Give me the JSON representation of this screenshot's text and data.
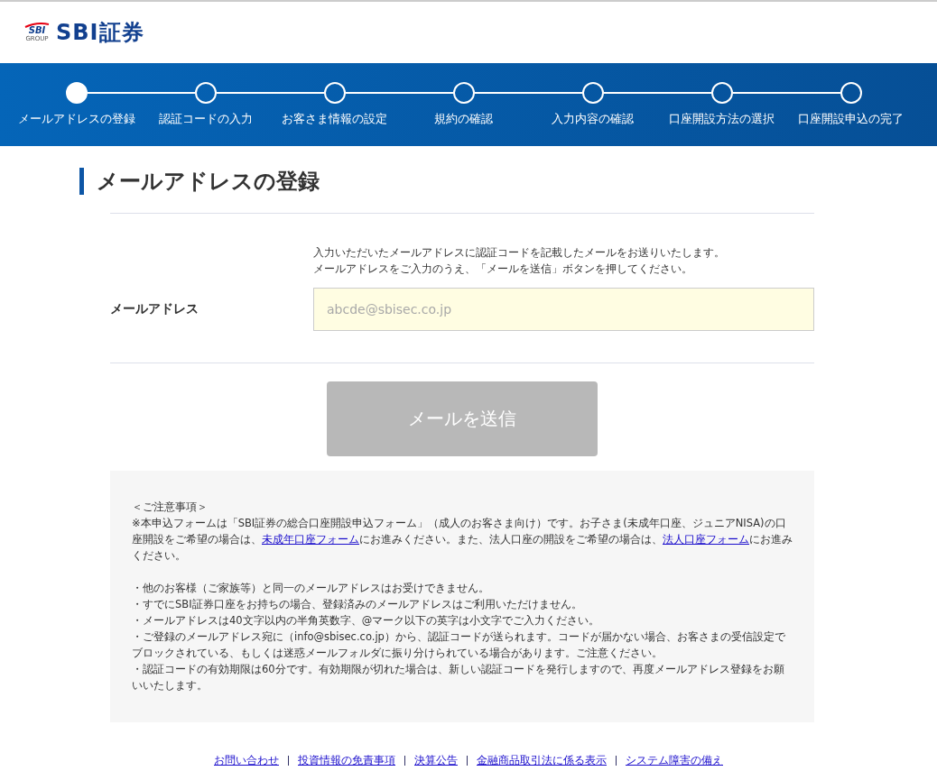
{
  "logo": {
    "badge": "SBI",
    "group": "GROUP",
    "name": "SBI証券"
  },
  "steps": [
    {
      "label": "メールアドレスの登録",
      "selected": true
    },
    {
      "label": "認証コードの入力",
      "selected": false
    },
    {
      "label": "お客さま情報の設定",
      "selected": false
    },
    {
      "label": "規約の確認",
      "selected": false
    },
    {
      "label": "入力内容の確認",
      "selected": false
    },
    {
      "label": "口座開設方法の選択",
      "selected": false
    },
    {
      "label": "口座開設申込の完了",
      "selected": false
    }
  ],
  "page_title": "メールアドレスの登録",
  "form": {
    "intro": [
      "入力いただいたメールアドレスに認証コードを記載したメールをお送りいたします。",
      "メールアドレスをご入力のうえ、「メールを送信」ボタンを押してください。"
    ],
    "label": "メールアドレス",
    "placeholder": "abcde@sbisec.co.jp"
  },
  "submit": {
    "label": "メールを送信",
    "disabled": true
  },
  "notice": {
    "heading": "＜ご注意事項＞",
    "intro": [
      {
        "text": "※本申込フォームは「SBI証券の総合口座開設申込フォーム」（成人のお客さま向け）です。お子さま(未成年口座、ジュニアNISA)の口座開設をご希望の場合は、",
        "link": false
      },
      {
        "text": "未成年口座フォーム",
        "link": true
      },
      {
        "text": "にお進みください。また、法人口座の開設をご希望の場合は、",
        "link": false
      },
      {
        "text": "法人口座フォーム",
        "link": true
      },
      {
        "text": "にお進みください。",
        "link": false
      }
    ],
    "items": [
      "・他のお客様（ご家族等）と同一のメールアドレスはお受けできません。",
      "・すでにSBI証券口座をお持ちの場合、登録済みのメールアドレスはご利用いただけません。",
      "・メールアドレスは40文字以内の半角英数字、@マーク以下の英字は小文字でご入力ください。",
      "・ご登録のメールアドレス宛に（info@sbisec.co.jp）から、認証コードが送られます。コードが届かない場合、お客さまの受信設定でブロックされている、もしくは迷惑メールフォルダに振り分けられている場合があります。ご注意ください。",
      "・認証コードの有効期限は60分です。有効期限が切れた場合は、新しい認証コードを発行しますので、再度メールアドレス登録をお願いいたします。"
    ]
  },
  "footer_links": [
    "お問い合わせ",
    "投資情報の免責事項",
    "決算公告",
    "金融商品取引法に係る表示",
    "システム障害の備え"
  ]
}
